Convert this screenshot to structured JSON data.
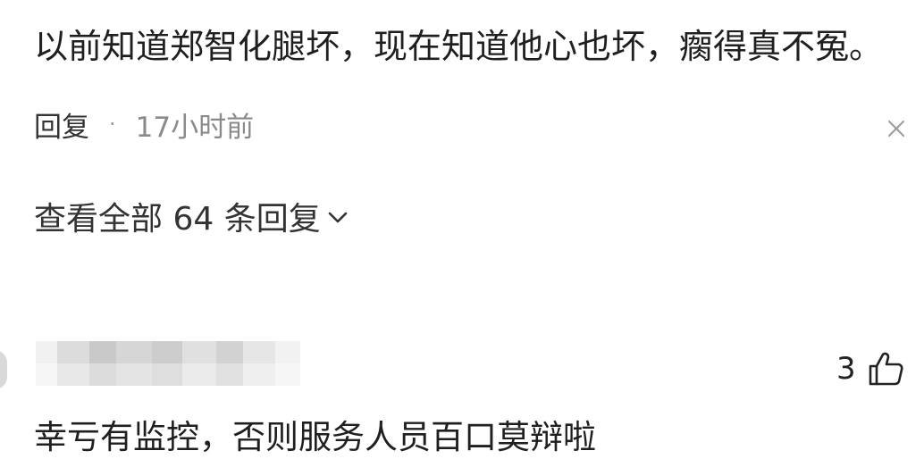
{
  "comment_1": {
    "text": "以前知道郑智化腿坏，现在知道他心也坏，瘸得真不冤。",
    "reply_label": "回复",
    "separator": "·",
    "time": "17小时前"
  },
  "replies": {
    "view_all_label": "查看全部 64 条回复"
  },
  "comment_2": {
    "username": "",
    "likes": "3",
    "text": "幸亏有监控，否则服务人员百口莫辩啦"
  },
  "icons": {
    "close": "close-icon",
    "chevron": "chevron-down-icon",
    "like": "thumbs-up-icon"
  },
  "colors": {
    "text_primary": "#1f1f1f",
    "text_secondary": "#8a8a8a",
    "background": "#ffffff"
  }
}
